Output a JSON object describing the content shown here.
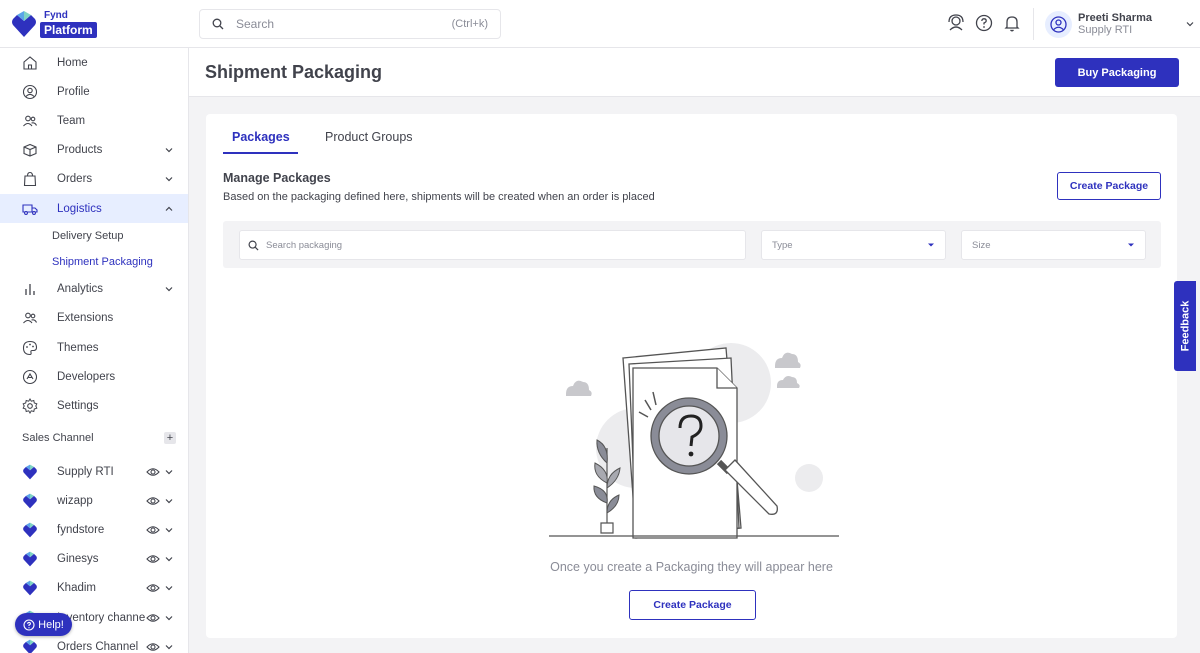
{
  "brand": {
    "top": "Fynd",
    "bottom": "Platform",
    "colors": {
      "accent": "#2e31be",
      "active_bg": "#e7eeff"
    }
  },
  "header": {
    "search_placeholder": "Search",
    "search_shortcut": "(Ctrl+k)",
    "user_name": "Preeti Sharma",
    "user_role": "Supply RTI"
  },
  "sidebar": {
    "items": [
      {
        "label": "Home",
        "icon": "home-icon"
      },
      {
        "label": "Profile",
        "icon": "profile-icon"
      },
      {
        "label": "Team",
        "icon": "team-icon"
      },
      {
        "label": "Products",
        "icon": "box-icon"
      },
      {
        "label": "Orders",
        "icon": "bag-icon"
      },
      {
        "label": "Logistics",
        "icon": "truck-icon"
      },
      {
        "label": "Analytics",
        "icon": "bar-chart-icon"
      },
      {
        "label": "Extensions",
        "icon": "extensions-icon"
      },
      {
        "label": "Themes",
        "icon": "palette-icon"
      },
      {
        "label": "Developers",
        "icon": "developers-icon"
      },
      {
        "label": "Settings",
        "icon": "gear-icon"
      }
    ],
    "logistics_sub": [
      "Delivery Setup",
      "Shipment Packaging"
    ],
    "sales_channel_title": "Sales Channel",
    "channels": [
      "Supply RTI",
      "wizapp",
      "fyndstore",
      "Ginesys",
      "Khadim",
      "Inventory channel",
      "Orders Channel"
    ]
  },
  "help_label": "Help!",
  "page": {
    "title": "Shipment Packaging",
    "buy_button": "Buy Packaging"
  },
  "tabs": [
    "Packages",
    "Product Groups"
  ],
  "manage": {
    "title": "Manage Packages",
    "description": "Based on the packaging defined here, shipments will be created when an order is placed",
    "create_button": "Create Package"
  },
  "filters": {
    "search_placeholder": "Search packaging",
    "type_placeholder": "Type",
    "size_placeholder": "Size"
  },
  "empty_state": {
    "text": "Once you create a Packaging they will appear here",
    "button": "Create Package"
  },
  "feedback_label": "Feedback"
}
